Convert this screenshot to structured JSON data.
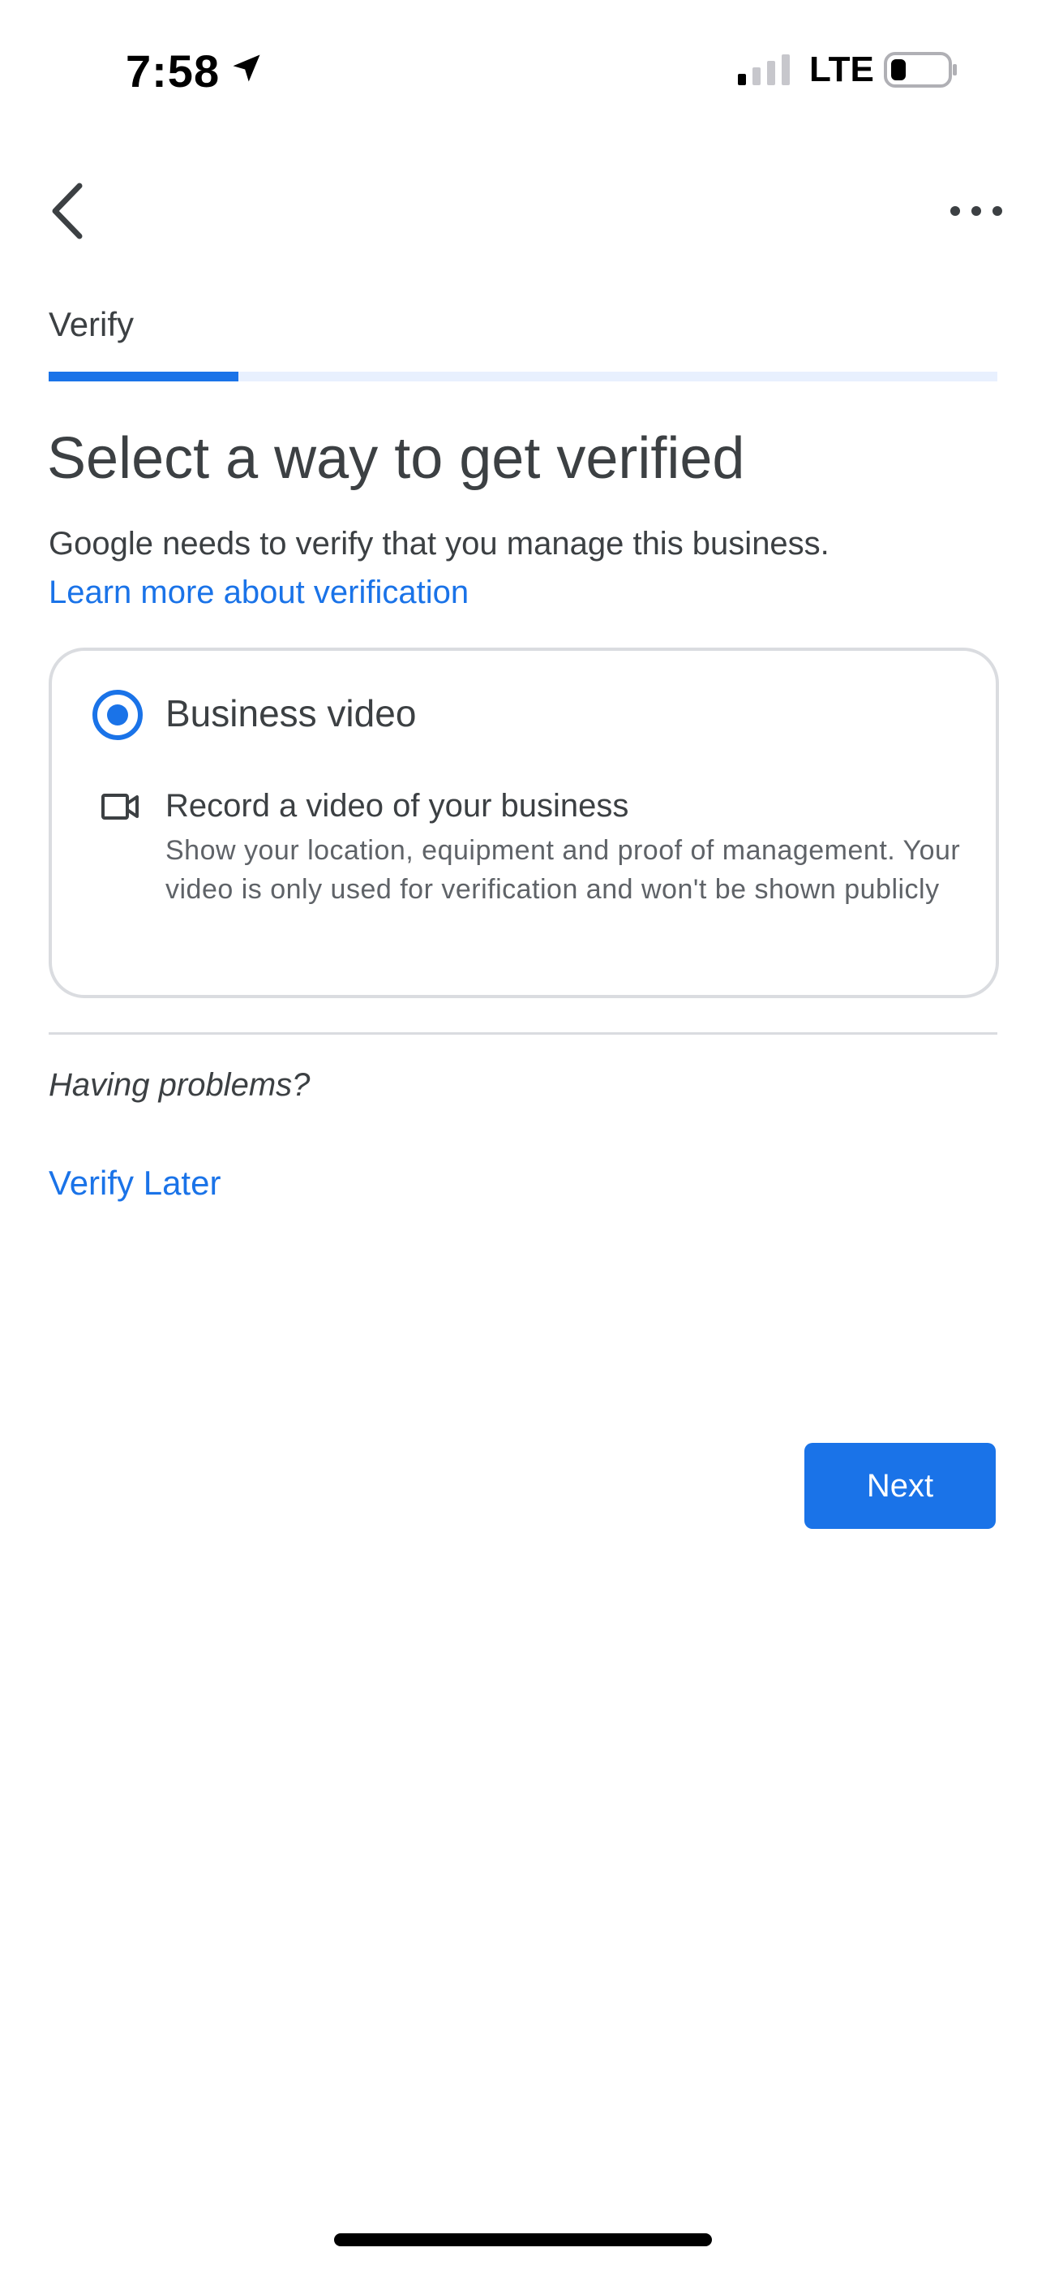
{
  "status_bar": {
    "time": "7:58",
    "network": "LTE",
    "icons": [
      "location-arrow-icon",
      "cellular-signal-icon",
      "battery-icon"
    ]
  },
  "nav": {
    "back_icon": "chevron-left-icon",
    "more_icon": "more-horizontal-icon"
  },
  "step": {
    "label": "Verify",
    "progress_fraction": 0.2
  },
  "title": "Select a way to get verified",
  "description": "Google needs to verify that you manage this business.",
  "learn_more": "Learn more about verification",
  "option": {
    "selected": true,
    "title": "Business video",
    "icon": "video-camera-icon",
    "subtitle": "Record a video of your business",
    "detail": "Show your location, equipment and proof of management. Your video is only used for verification and won't be shown publicly"
  },
  "problems_text": "Having problems?",
  "verify_later": "Verify Later",
  "next_button": "Next",
  "colors": {
    "accent": "#1a73e8",
    "progress_track": "#e8f0fe",
    "text": "#3c4043",
    "secondary_text": "#5f6368",
    "border": "#dadce0"
  }
}
